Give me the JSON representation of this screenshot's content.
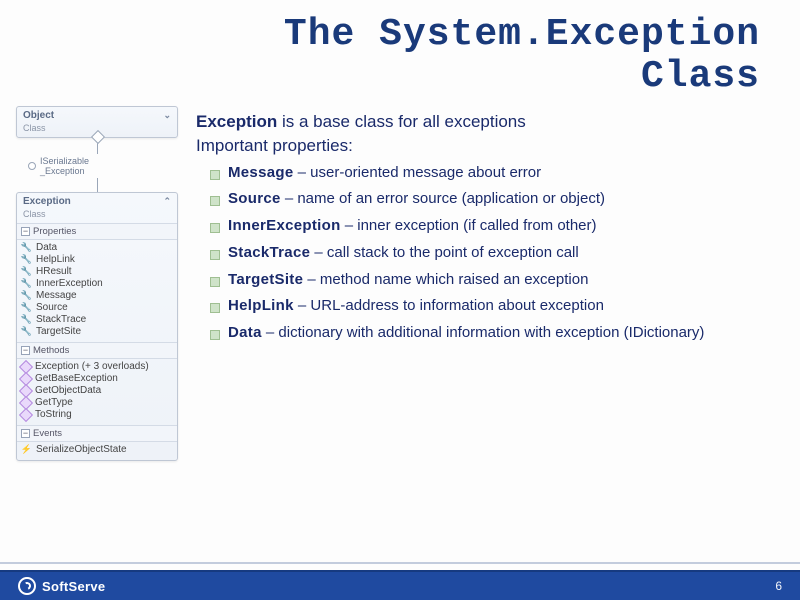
{
  "title_line1": "The System.Exception",
  "title_line2": "Class",
  "diagram": {
    "object_box": {
      "name": "Object",
      "stereotype": "Class"
    },
    "interface": {
      "name": "ISerializable",
      "backing": "_Exception"
    },
    "exception_box": {
      "name": "Exception",
      "stereotype": "Class"
    },
    "sections": {
      "properties": {
        "label": "Properties",
        "items": [
          "Data",
          "HelpLink",
          "HResult",
          "InnerException",
          "Message",
          "Source",
          "StackTrace",
          "TargetSite"
        ]
      },
      "methods": {
        "label": "Methods",
        "items": [
          "Exception (+ 3 overloads)",
          "GetBaseException",
          "GetObjectData",
          "GetType",
          "ToString"
        ]
      },
      "events": {
        "label": "Events",
        "items": [
          "SerializeObjectState"
        ]
      }
    }
  },
  "body": {
    "lead_bold": "Exception",
    "lead_rest": " is a base class for all exceptions",
    "subhead": "Important properties:",
    "bullets": [
      {
        "name": "Message",
        "desc": " – user-oriented message about error"
      },
      {
        "name": "Source",
        "desc": " – name of an error source (application or object)"
      },
      {
        "name": "InnerException",
        "desc": " – inner exception (if called from other)"
      },
      {
        "name": "StackTrace",
        "desc": " – call stack to the point of exception call"
      },
      {
        "name": "TargetSite",
        "desc": " – method name which raised an exception"
      },
      {
        "name": "HelpLink",
        "desc": " – URL-address to information about exception"
      },
      {
        "name": "Data",
        "desc": " – dictionary with additional information with exception (IDictionary)"
      }
    ]
  },
  "footer": {
    "brand": "SoftServe",
    "page": "6"
  }
}
